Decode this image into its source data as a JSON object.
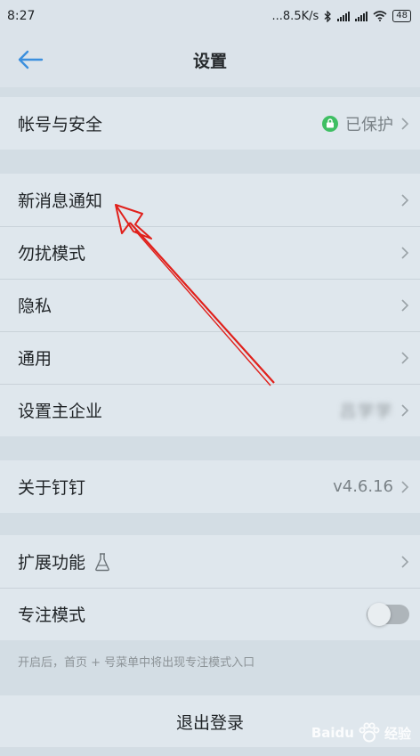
{
  "status_bar": {
    "time": "8:27",
    "network_speed": "...8.5K/s",
    "battery": "48"
  },
  "header": {
    "title": "设置"
  },
  "sections": {
    "account": {
      "label": "帐号与安全",
      "status": "已保护"
    },
    "notify": {
      "label": "新消息通知"
    },
    "dnd": {
      "label": "勿扰模式"
    },
    "privacy": {
      "label": "隐私"
    },
    "general": {
      "label": "通用"
    },
    "main_company": {
      "label": "设置主企业",
      "value": "吕学学"
    },
    "about": {
      "label": "关于钉钉",
      "version": "v4.6.16"
    },
    "extensions": {
      "label": "扩展功能"
    },
    "focus": {
      "label": "专注模式",
      "enabled": false
    }
  },
  "hint": "开启后，首页 + 号菜单中将出现专注模式入口",
  "logout_label": "退出登录",
  "watermark": {
    "brand": "Baidu",
    "suffix": "经验"
  },
  "colors": {
    "accent_blue": "#3b8fde",
    "lock_green": "#3fbf63",
    "annotation_red": "#e0201b"
  }
}
